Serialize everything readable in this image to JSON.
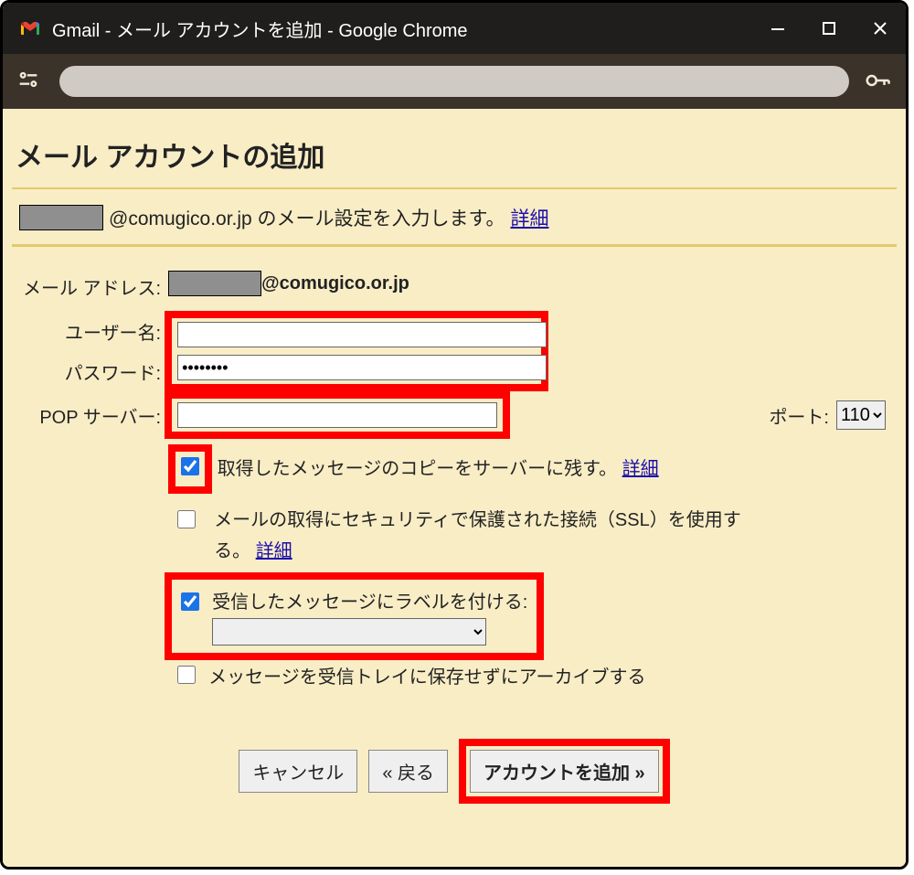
{
  "window": {
    "title": "Gmail - メール アカウントを追加 - Google Chrome"
  },
  "page": {
    "heading": "メール アカウントの追加",
    "subtitle_suffix": "@comugico.or.jp のメール設定を入力します。",
    "learn_more": "詳細"
  },
  "form": {
    "email_label": "メール アドレス:",
    "email_domain": "@comugico.or.jp",
    "username_label": "ユーザー名:",
    "username_value": "",
    "password_label": "パスワード:",
    "password_value": "••••••••",
    "pop_label": "POP サーバー:",
    "pop_value": "",
    "port_label": "ポート:",
    "port_value": "110",
    "opt_leave_copy": "取得したメッセージのコピーをサーバーに残す。",
    "opt_ssl": "メールの取得にセキュリティで保護された接続（SSL）を使用する。",
    "opt_label_incoming": "受信したメッセージにラベルを付ける:",
    "opt_archive": "メッセージを受信トレイに保存せずにアーカイブする",
    "label_select_value": ""
  },
  "buttons": {
    "cancel": "キャンセル",
    "back": "« 戻る",
    "add": "アカウントを追加 »"
  }
}
